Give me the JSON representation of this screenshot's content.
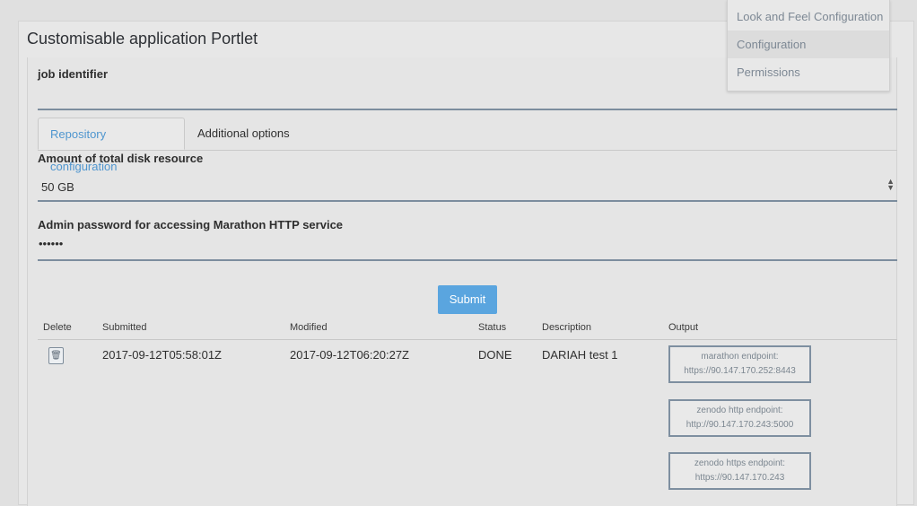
{
  "portlet": {
    "title": "Customisable application Portlet"
  },
  "menu": {
    "items": [
      {
        "label": "Look and Feel Configuration"
      },
      {
        "label": "Configuration"
      },
      {
        "label": "Permissions"
      }
    ]
  },
  "form": {
    "job_identifier_label": "job identifier",
    "tabs": [
      {
        "label": "Repository configuration",
        "active": true
      },
      {
        "label": "Additional options",
        "active": false
      }
    ],
    "disk_label": "Amount of total disk resource",
    "disk_value": "50 GB",
    "password_label": "Admin password for accessing Marathon HTTP service",
    "password_value": "••••••",
    "submit_label": "Submit"
  },
  "table": {
    "headers": [
      "Delete",
      "Submitted",
      "Modified",
      "Status",
      "Description",
      "Output"
    ],
    "rows": [
      {
        "submitted": "2017-09-12T05:58:01Z",
        "modified": "2017-09-12T06:20:27Z",
        "status": "DONE",
        "description": "DARIAH test 1",
        "outputs": [
          {
            "name": "marathon endpoint:",
            "url": "https://90.147.170.252:8443"
          },
          {
            "name": "zenodo http endpoint:",
            "url": "http://90.147.170.243:5000"
          },
          {
            "name": "zenodo https endpoint:",
            "url": "https://90.147.170.243"
          }
        ]
      }
    ]
  },
  "colors": {
    "accent": "#5aa5df",
    "tab_active": "#4f96cf",
    "underline": "#7c8d9e"
  }
}
